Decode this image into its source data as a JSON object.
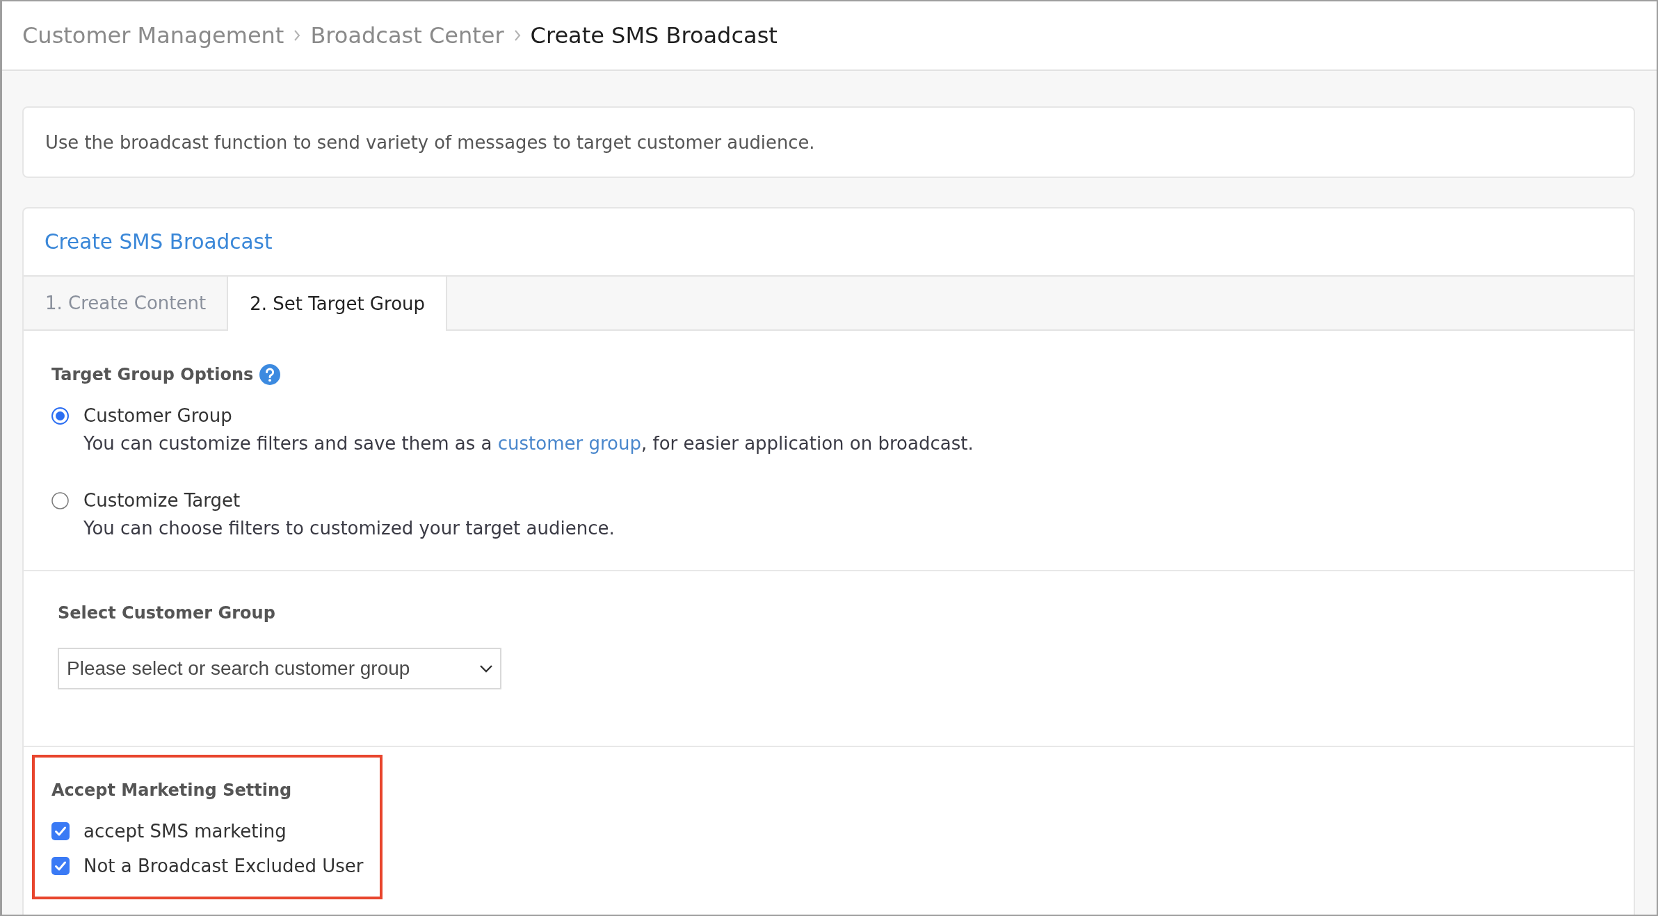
{
  "breadcrumb": [
    {
      "label": "Customer Management",
      "current": false
    },
    {
      "label": "Broadcast Center",
      "current": false
    },
    {
      "label": "Create SMS Broadcast",
      "current": true
    }
  ],
  "notice": {
    "text": "Use the broadcast function to send variety of messages to target customer audience."
  },
  "panel": {
    "title": "Create SMS Broadcast",
    "tabs": [
      {
        "label": "1. Create Content",
        "selected": false
      },
      {
        "label": "2. Set Target Group",
        "selected": true
      }
    ],
    "target_group_options": {
      "heading": "Target Group Options",
      "options": [
        {
          "label": "Customer Group",
          "selected": true,
          "description": [
            {
              "kind": "text",
              "text": "You can customize filters and save them as a "
            },
            {
              "kind": "link",
              "text": "customer group"
            },
            {
              "kind": "text",
              "text": ", for easier application on broadcast."
            }
          ]
        },
        {
          "label": "Customize Target",
          "selected": false,
          "description": [
            {
              "kind": "text",
              "text": "You can choose filters to customized your target audience."
            }
          ]
        }
      ]
    },
    "select_customer_group": {
      "heading": "Select Customer Group",
      "dropdown": {
        "placeholder": "Please select or search customer group"
      }
    },
    "accept_marketing_setting": {
      "heading": "Accept Marketing Setting",
      "highlighted": true,
      "options": [
        {
          "label": "accept SMS marketing",
          "checked": true
        },
        {
          "label": "Not a Broadcast Excluded User",
          "checked": true
        }
      ]
    }
  }
}
